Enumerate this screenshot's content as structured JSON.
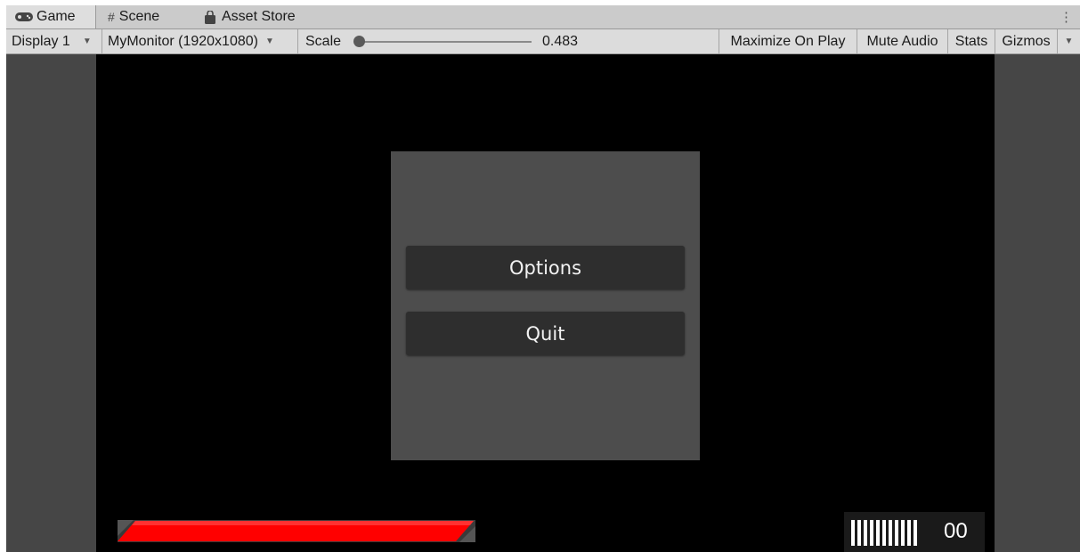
{
  "tabs": [
    {
      "label": "Game",
      "icon": "gamepad-icon",
      "active": true
    },
    {
      "label": "Scene",
      "icon": "hash-grid-icon",
      "active": false
    },
    {
      "label": "Asset Store",
      "icon": "shopping-bag-icon",
      "active": false
    }
  ],
  "toolbar": {
    "display": "Display 1",
    "resolution": "MyMonitor (1920x1080)",
    "scale_label": "Scale",
    "scale_value": "0.483",
    "maximize_on_play": "Maximize On Play",
    "mute_audio": "Mute Audio",
    "stats": "Stats",
    "gizmos": "Gizmos"
  },
  "menu": {
    "options_label": "Options",
    "quit_label": "Quit"
  },
  "hud": {
    "health_fraction": 1.0,
    "health_color": "#ff0000",
    "ammo_bars": 11,
    "ammo_count": "00"
  }
}
